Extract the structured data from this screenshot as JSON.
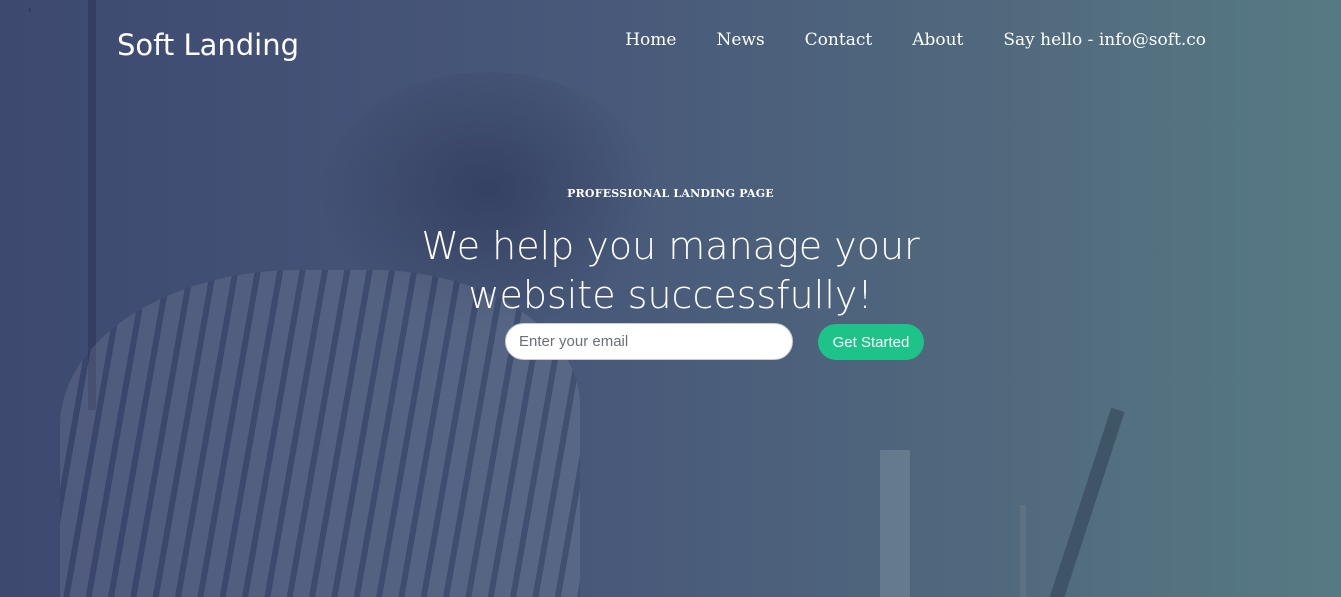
{
  "header": {
    "brand": "Soft Landing",
    "nav": [
      {
        "label": "Home"
      },
      {
        "label": "News"
      },
      {
        "label": "Contact"
      },
      {
        "label": "About"
      },
      {
        "label": "Say hello - info@soft.co"
      }
    ]
  },
  "hero": {
    "eyebrow": "PROFESSIONAL LANDING PAGE",
    "headline_line1": "We help you manage your",
    "headline_line2": "website successfully!",
    "email_placeholder": "Enter your email",
    "email_value": "",
    "cta_label": "Get Started"
  },
  "colors": {
    "overlay_start": "#3d4970",
    "overlay_end": "#567a84",
    "cta": "#1ec38a"
  }
}
